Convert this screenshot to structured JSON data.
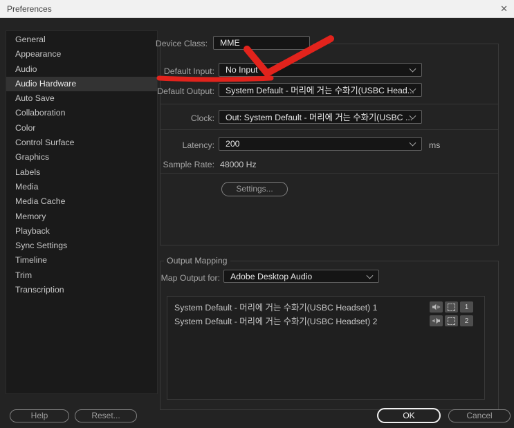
{
  "window": {
    "title": "Preferences",
    "close_glyph": "✕"
  },
  "sidebar": {
    "items": [
      {
        "label": "General",
        "selected": false
      },
      {
        "label": "Appearance",
        "selected": false
      },
      {
        "label": "Audio",
        "selected": false
      },
      {
        "label": "Audio Hardware",
        "selected": true
      },
      {
        "label": "Auto Save",
        "selected": false
      },
      {
        "label": "Collaboration",
        "selected": false
      },
      {
        "label": "Color",
        "selected": false
      },
      {
        "label": "Control Surface",
        "selected": false
      },
      {
        "label": "Graphics",
        "selected": false
      },
      {
        "label": "Labels",
        "selected": false
      },
      {
        "label": "Media",
        "selected": false
      },
      {
        "label": "Media Cache",
        "selected": false
      },
      {
        "label": "Memory",
        "selected": false
      },
      {
        "label": "Playback",
        "selected": false
      },
      {
        "label": "Sync Settings",
        "selected": false
      },
      {
        "label": "Timeline",
        "selected": false
      },
      {
        "label": "Trim",
        "selected": false
      },
      {
        "label": "Transcription",
        "selected": false
      }
    ]
  },
  "panel": {
    "device_class": {
      "label": "Device Class:",
      "value": "MME"
    },
    "default_input": {
      "label": "Default Input:",
      "value": "No Input"
    },
    "default_output": {
      "label": "Default Output:",
      "value": "System Default - 머리에 거는 수화기(USBC Head..."
    },
    "clock": {
      "label": "Clock:",
      "value": "Out: System Default - 머리에 거는 수화기(USBC ..."
    },
    "latency": {
      "label": "Latency:",
      "value": "200",
      "unit": "ms"
    },
    "sample_rate": {
      "label": "Sample Rate:",
      "value": "48000 Hz"
    },
    "settings_button_label": "Settings..."
  },
  "output_mapping": {
    "section_label": "Output Mapping",
    "map_output_for": {
      "label": "Map Output for:",
      "value": "Adobe Desktop Audio"
    },
    "channels": [
      {
        "name": "System Default - 머리에 거는 수화기(USBC Headset) 1",
        "number": "1"
      },
      {
        "name": "System Default - 머리에 거는 수화기(USBC Headset) 2",
        "number": "2"
      }
    ]
  },
  "footer": {
    "help_label": "Help",
    "reset_label": "Reset...",
    "ok_label": "OK",
    "cancel_label": "Cancel"
  },
  "annotation": {
    "color": "#e2231c"
  }
}
